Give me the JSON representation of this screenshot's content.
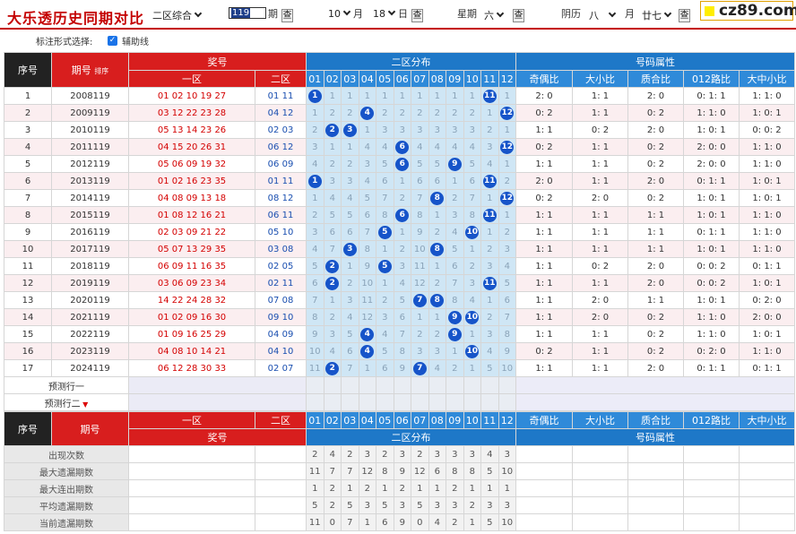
{
  "topbar": {
    "title": "大乐透历史同期对比",
    "zone_select": "二区综合",
    "period_input": "119",
    "period_label": "期",
    "query_label": "查",
    "month_value": "10",
    "month_label": "月",
    "day_value": "18",
    "day_label": "日",
    "weekday_label": "星期",
    "weekday_value": "六",
    "lunar_label": "阴历",
    "lunar_month_value": "八",
    "lunar_month_label": "月",
    "lunar_day_value": "廿七",
    "logo_text": "cz89.com"
  },
  "assist": {
    "label": "标注形式选择:",
    "checkbox_label": "辅助线"
  },
  "header": {
    "seq": "序号",
    "period": "期号",
    "period_sort": "排序",
    "prize": "奖号",
    "zone1": "一区",
    "zone2": "二区",
    "distribution": "二区分布",
    "attributes": "号码属性",
    "numbers": [
      "01",
      "02",
      "03",
      "04",
      "05",
      "06",
      "07",
      "08",
      "09",
      "10",
      "11",
      "12"
    ],
    "attr_cols": [
      "奇偶比",
      "大小比",
      "质合比",
      "012路比",
      "大中小比"
    ]
  },
  "rows": [
    {
      "seq": "1",
      "period": "2008119",
      "front": "01 02 10 19 27",
      "back": "01 11",
      "dist": [
        "1",
        "1",
        "1",
        "1",
        "1",
        "1",
        "1",
        "1",
        "1",
        "1",
        "11",
        "1"
      ],
      "hits": [
        0,
        10
      ],
      "attrs": [
        "2: 0",
        "1: 1",
        "2: 0",
        "0: 1: 1",
        "1: 1: 0"
      ]
    },
    {
      "seq": "2",
      "period": "2009119",
      "front": "03 12 22 23 28",
      "back": "04 12",
      "dist": [
        "1",
        "2",
        "2",
        "4",
        "2",
        "2",
        "2",
        "2",
        "2",
        "2",
        "1",
        "12"
      ],
      "hits": [
        3,
        11
      ],
      "attrs": [
        "0: 2",
        "1: 1",
        "0: 2",
        "1: 1: 0",
        "1: 0: 1"
      ]
    },
    {
      "seq": "3",
      "period": "2010119",
      "front": "05 13 14 23 26",
      "back": "02 03",
      "dist": [
        "2",
        "2",
        "3",
        "1",
        "3",
        "3",
        "3",
        "3",
        "3",
        "3",
        "2",
        "1"
      ],
      "hits": [
        1,
        2
      ],
      "attrs": [
        "1: 1",
        "0: 2",
        "2: 0",
        "1: 0: 1",
        "0: 0: 2"
      ]
    },
    {
      "seq": "4",
      "period": "2011119",
      "front": "04 15 20 26 31",
      "back": "06 12",
      "dist": [
        "3",
        "1",
        "1",
        "4",
        "4",
        "6",
        "4",
        "4",
        "4",
        "4",
        "3",
        "12"
      ],
      "hits": [
        5,
        11
      ],
      "attrs": [
        "0: 2",
        "1: 1",
        "0: 2",
        "2: 0: 0",
        "1: 1: 0"
      ]
    },
    {
      "seq": "5",
      "period": "2012119",
      "front": "05 06 09 19 32",
      "back": "06 09",
      "dist": [
        "4",
        "2",
        "2",
        "3",
        "5",
        "6",
        "5",
        "5",
        "9",
        "5",
        "4",
        "1"
      ],
      "hits": [
        5,
        8
      ],
      "attrs": [
        "1: 1",
        "1: 1",
        "0: 2",
        "2: 0: 0",
        "1: 1: 0"
      ]
    },
    {
      "seq": "6",
      "period": "2013119",
      "front": "01 02 16 23 35",
      "back": "01 11",
      "dist": [
        "1",
        "3",
        "3",
        "4",
        "6",
        "1",
        "6",
        "6",
        "1",
        "6",
        "11",
        "2"
      ],
      "hits": [
        0,
        10
      ],
      "attrs": [
        "2: 0",
        "1: 1",
        "2: 0",
        "0: 1: 1",
        "1: 0: 1"
      ]
    },
    {
      "seq": "7",
      "period": "2014119",
      "front": "04 08 09 13 18",
      "back": "08 12",
      "dist": [
        "1",
        "4",
        "4",
        "5",
        "7",
        "2",
        "7",
        "8",
        "2",
        "7",
        "1",
        "12"
      ],
      "hits": [
        7,
        11
      ],
      "attrs": [
        "0: 2",
        "2: 0",
        "0: 2",
        "1: 0: 1",
        "1: 0: 1"
      ]
    },
    {
      "seq": "8",
      "period": "2015119",
      "front": "01 08 12 16 21",
      "back": "06 11",
      "dist": [
        "2",
        "5",
        "5",
        "6",
        "8",
        "6",
        "8",
        "1",
        "3",
        "8",
        "11",
        "1"
      ],
      "hits": [
        5,
        10
      ],
      "attrs": [
        "1: 1",
        "1: 1",
        "1: 1",
        "1: 0: 1",
        "1: 1: 0"
      ]
    },
    {
      "seq": "9",
      "period": "2016119",
      "front": "02 03 09 21 22",
      "back": "05 10",
      "dist": [
        "3",
        "6",
        "6",
        "7",
        "5",
        "1",
        "9",
        "2",
        "4",
        "10",
        "1",
        "2"
      ],
      "hits": [
        4,
        9
      ],
      "attrs": [
        "1: 1",
        "1: 1",
        "1: 1",
        "0: 1: 1",
        "1: 1: 0"
      ]
    },
    {
      "seq": "10",
      "period": "2017119",
      "front": "05 07 13 29 35",
      "back": "03 08",
      "dist": [
        "4",
        "7",
        "3",
        "8",
        "1",
        "2",
        "10",
        "8",
        "5",
        "1",
        "2",
        "3"
      ],
      "hits": [
        2,
        7
      ],
      "attrs": [
        "1: 1",
        "1: 1",
        "1: 1",
        "1: 0: 1",
        "1: 1: 0"
      ]
    },
    {
      "seq": "11",
      "period": "2018119",
      "front": "06 09 11 16 35",
      "back": "02 05",
      "dist": [
        "5",
        "2",
        "1",
        "9",
        "5",
        "3",
        "11",
        "1",
        "6",
        "2",
        "3",
        "4"
      ],
      "hits": [
        1,
        4
      ],
      "attrs": [
        "1: 1",
        "0: 2",
        "2: 0",
        "0: 0: 2",
        "0: 1: 1"
      ]
    },
    {
      "seq": "12",
      "period": "2019119",
      "front": "03 06 09 23 34",
      "back": "02 11",
      "dist": [
        "6",
        "2",
        "2",
        "10",
        "1",
        "4",
        "12",
        "2",
        "7",
        "3",
        "11",
        "5"
      ],
      "hits": [
        1,
        10
      ],
      "attrs": [
        "1: 1",
        "1: 1",
        "2: 0",
        "0: 0: 2",
        "1: 0: 1"
      ]
    },
    {
      "seq": "13",
      "period": "2020119",
      "front": "14 22 24 28 32",
      "back": "07 08",
      "dist": [
        "7",
        "1",
        "3",
        "11",
        "2",
        "5",
        "7",
        "8",
        "8",
        "4",
        "1",
        "6"
      ],
      "hits": [
        6,
        7
      ],
      "attrs": [
        "1: 1",
        "2: 0",
        "1: 1",
        "1: 0: 1",
        "0: 2: 0"
      ]
    },
    {
      "seq": "14",
      "period": "2021119",
      "front": "01 02 09 16 30",
      "back": "09 10",
      "dist": [
        "8",
        "2",
        "4",
        "12",
        "3",
        "6",
        "1",
        "1",
        "9",
        "10",
        "2",
        "7"
      ],
      "hits": [
        8,
        9
      ],
      "attrs": [
        "1: 1",
        "2: 0",
        "0: 2",
        "1: 1: 0",
        "2: 0: 0"
      ]
    },
    {
      "seq": "15",
      "period": "2022119",
      "front": "01 09 16 25 29",
      "back": "04 09",
      "dist": [
        "9",
        "3",
        "5",
        "4",
        "4",
        "7",
        "2",
        "2",
        "9",
        "1",
        "3",
        "8"
      ],
      "hits": [
        3,
        8
      ],
      "attrs": [
        "1: 1",
        "1: 1",
        "0: 2",
        "1: 1: 0",
        "1: 0: 1"
      ]
    },
    {
      "seq": "16",
      "period": "2023119",
      "front": "04 08 10 14 21",
      "back": "04 10",
      "dist": [
        "10",
        "4",
        "6",
        "4",
        "5",
        "8",
        "3",
        "3",
        "1",
        "10",
        "4",
        "9"
      ],
      "hits": [
        3,
        9
      ],
      "attrs": [
        "0: 2",
        "1: 1",
        "0: 2",
        "0: 2: 0",
        "1: 1: 0"
      ]
    },
    {
      "seq": "17",
      "period": "2024119",
      "front": "06 12 28 30 33",
      "back": "02 07",
      "dist": [
        "11",
        "2",
        "7",
        "1",
        "6",
        "9",
        "7",
        "4",
        "2",
        "1",
        "5",
        "10"
      ],
      "hits": [
        1,
        6
      ],
      "attrs": [
        "1: 1",
        "1: 1",
        "2: 0",
        "0: 1: 1",
        "0: 1: 1"
      ]
    }
  ],
  "predict": [
    "预测行一",
    "预测行二"
  ],
  "stats": [
    {
      "label": "出现次数",
      "values": [
        "2",
        "4",
        "2",
        "3",
        "2",
        "3",
        "2",
        "3",
        "3",
        "3",
        "4",
        "3"
      ]
    },
    {
      "label": "最大遗漏期数",
      "values": [
        "11",
        "7",
        "7",
        "12",
        "8",
        "9",
        "12",
        "6",
        "8",
        "8",
        "5",
        "10"
      ]
    },
    {
      "label": "最大连出期数",
      "values": [
        "1",
        "2",
        "1",
        "2",
        "1",
        "2",
        "1",
        "1",
        "2",
        "1",
        "1",
        "1"
      ]
    },
    {
      "label": "平均遗漏期数",
      "values": [
        "5",
        "2",
        "5",
        "3",
        "5",
        "3",
        "5",
        "3",
        "3",
        "2",
        "3",
        "3"
      ]
    },
    {
      "label": "当前遗漏期数",
      "values": [
        "11",
        "0",
        "7",
        "1",
        "6",
        "9",
        "0",
        "4",
        "2",
        "1",
        "5",
        "10"
      ]
    }
  ],
  "colors": {
    "accent_red": "#d81e1e",
    "accent_blue": "#1e78c8",
    "ball": "#1654c9",
    "zone_bg": "#cfe6f5"
  }
}
